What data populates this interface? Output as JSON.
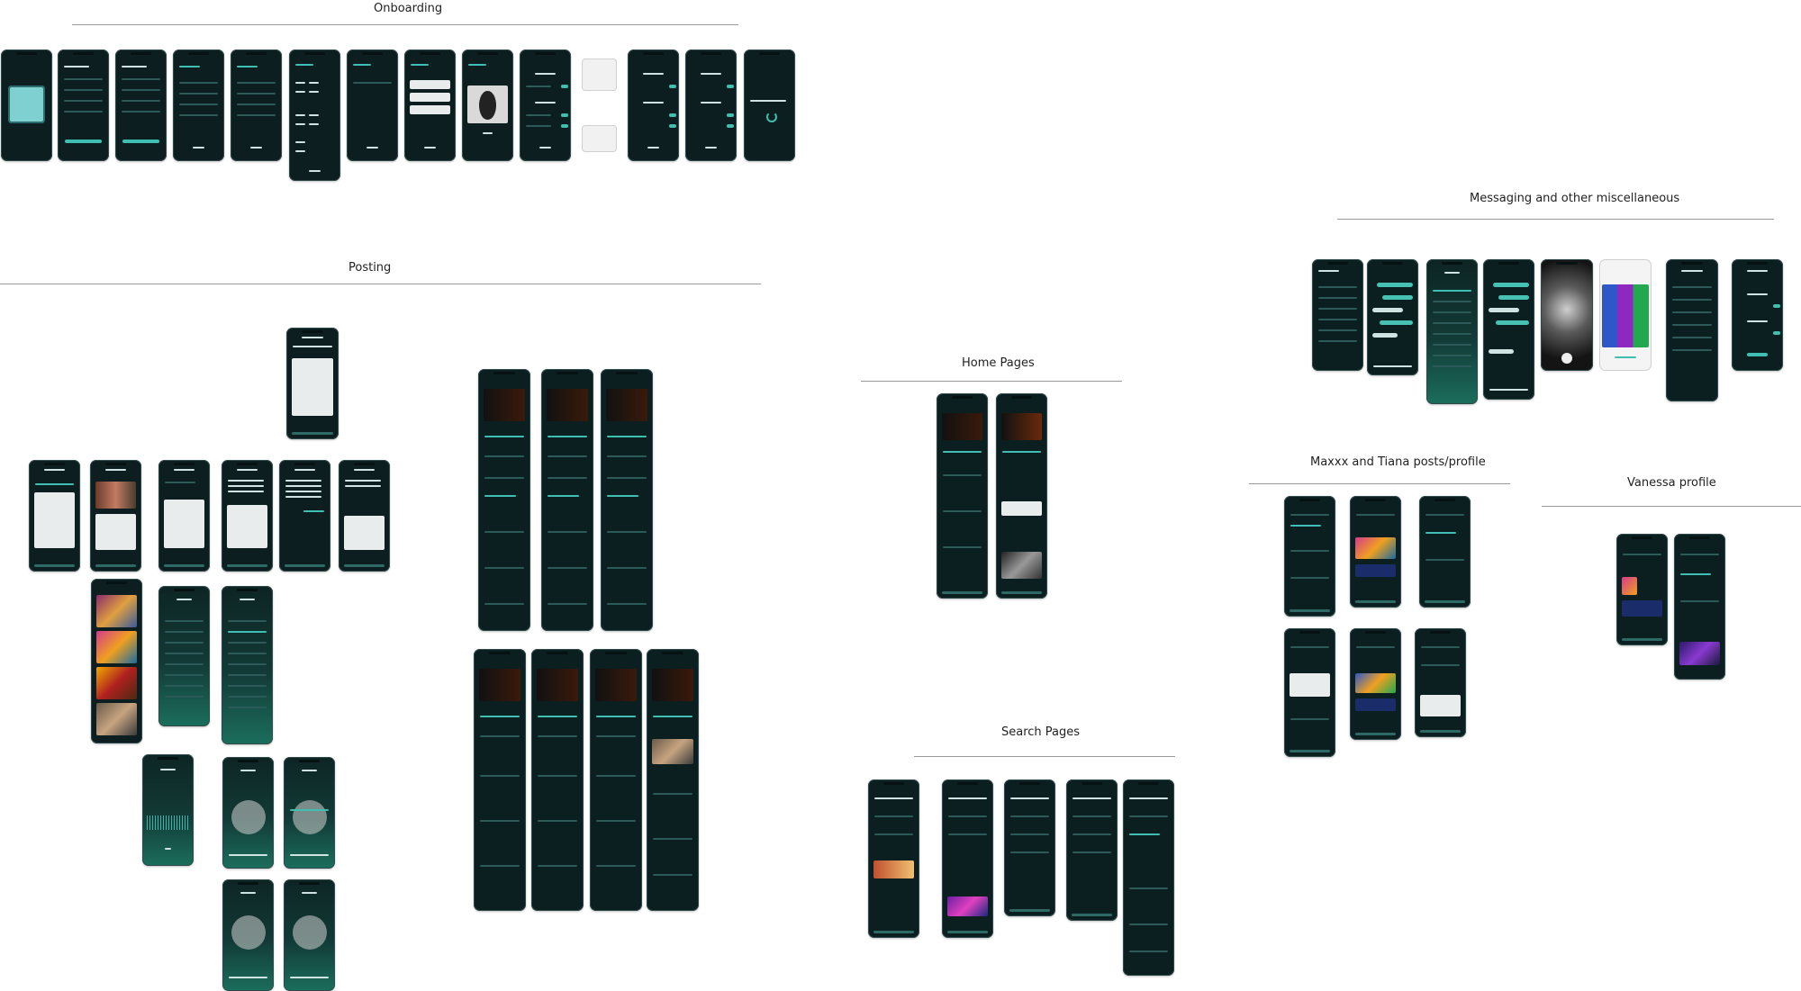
{
  "sections": {
    "onboarding": "Onboarding",
    "posting": "Posting",
    "home_pages": "Home Pages",
    "search_pages": "Search Pages",
    "messaging": "Messaging and other miscellaneous",
    "maxxx_tiana": "Maxxx and Tiana posts/profile",
    "vanessa": "Vanessa profile"
  },
  "colors": {
    "phone_bg": "#0c1e1f",
    "accent": "#3fbfb2",
    "canvas": "#ffffff"
  }
}
